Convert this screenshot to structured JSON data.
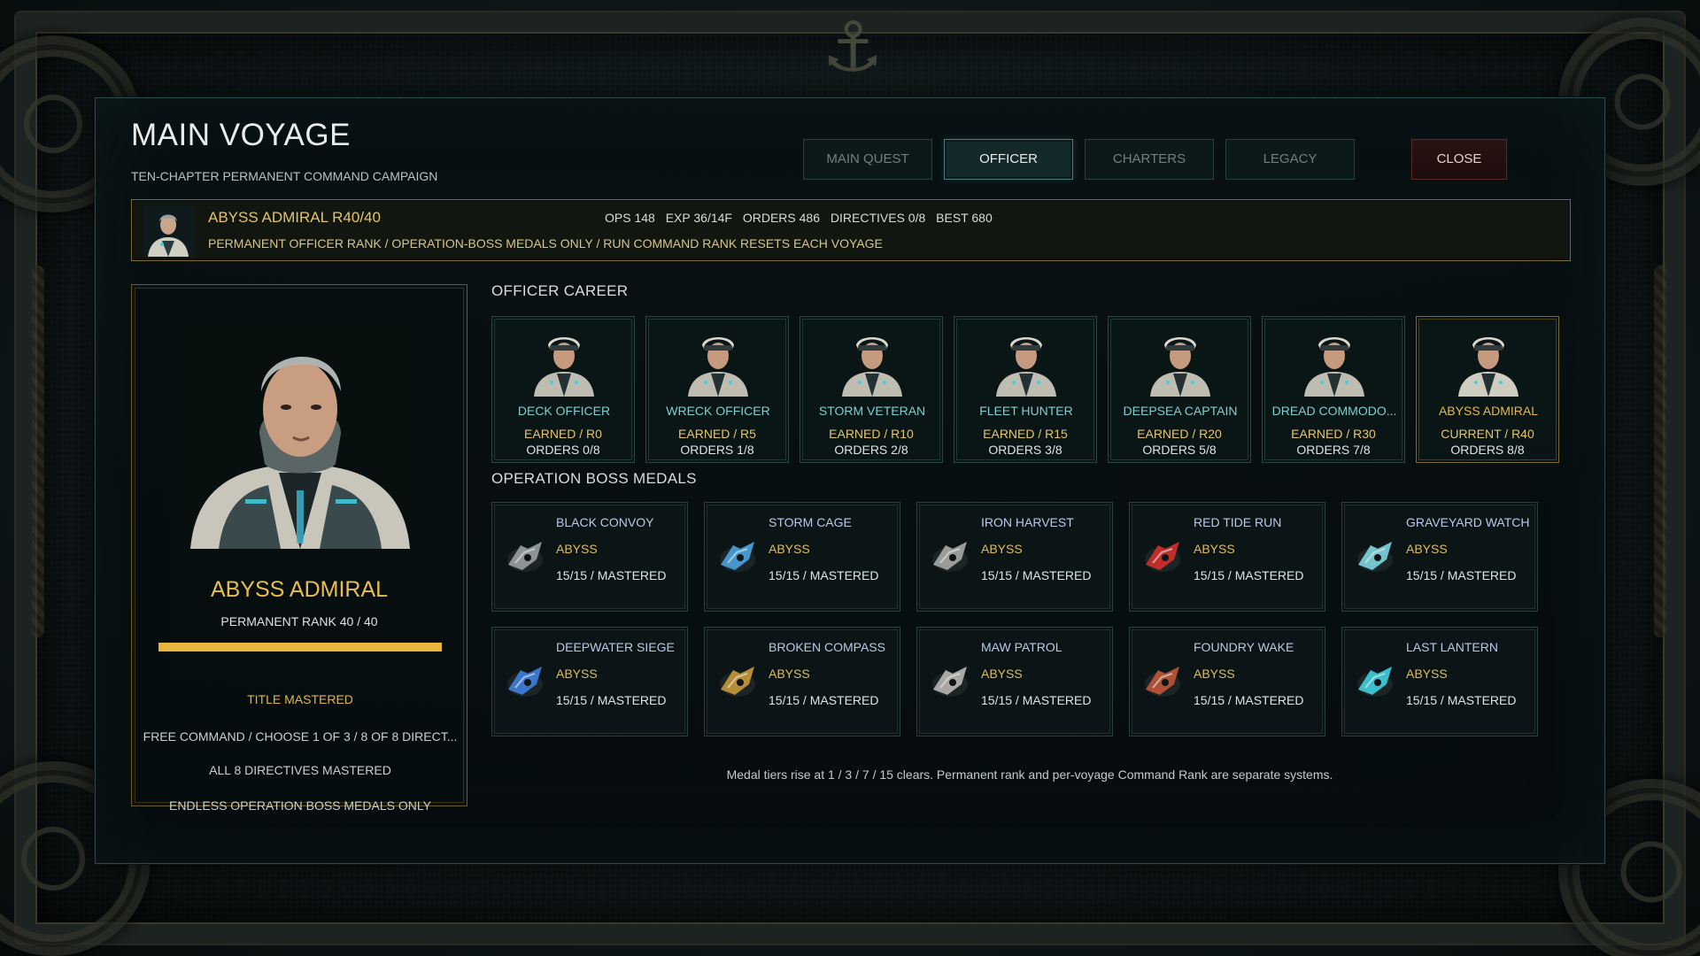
{
  "header": {
    "title": "MAIN VOYAGE",
    "subtitle": "TEN-CHAPTER PERMANENT COMMAND CAMPAIGN"
  },
  "tabs": [
    {
      "label": "MAIN QUEST",
      "active": false
    },
    {
      "label": "OFFICER",
      "active": true
    },
    {
      "label": "CHARTERS",
      "active": false
    },
    {
      "label": "LEGACY",
      "active": false
    }
  ],
  "close_label": "CLOSE",
  "banner": {
    "name": "ABYSS ADMIRAL  R40/40",
    "stats": {
      "ops": "OPS 148",
      "exp": "EXP 36/14F",
      "orders": "ORDERS 486",
      "directives": "DIRECTIVES 0/8",
      "best": "BEST 680"
    },
    "note": "PERMANENT OFFICER RANK / OPERATION-BOSS MEDALS ONLY / RUN COMMAND RANK RESETS EACH VOYAGE"
  },
  "profile": {
    "name": "ABYSS ADMIRAL",
    "rank": "PERMANENT RANK 40 / 40",
    "rank_progress": 1.0,
    "title_status": "TITLE MASTERED",
    "command_line": "FREE COMMAND / CHOOSE 1 OF 3 / 8 OF 8 DIRECT...",
    "directives_line": "ALL 8 DIRECTIVES MASTERED",
    "medals_line": "ENDLESS OPERATION BOSS MEDALS ONLY"
  },
  "officer_career": {
    "title": "OFFICER CAREER",
    "officers": [
      {
        "name": "DECK OFFICER",
        "status": "EARNED / R0",
        "orders": "ORDERS 0/8",
        "current": false
      },
      {
        "name": "WRECK OFFICER",
        "status": "EARNED / R5",
        "orders": "ORDERS 1/8",
        "current": false
      },
      {
        "name": "STORM VETERAN",
        "status": "EARNED / R10",
        "orders": "ORDERS 2/8",
        "current": false
      },
      {
        "name": "FLEET HUNTER",
        "status": "EARNED / R15",
        "orders": "ORDERS 3/8",
        "current": false
      },
      {
        "name": "DEEPSEA CAPTAIN",
        "status": "EARNED / R20",
        "orders": "ORDERS 5/8",
        "current": false
      },
      {
        "name": "DREAD COMMODO...",
        "status": "EARNED / R30",
        "orders": "ORDERS 7/8",
        "current": false
      },
      {
        "name": "ABYSS ADMIRAL",
        "status": "CURRENT / R40",
        "orders": "ORDERS 8/8",
        "current": true
      }
    ]
  },
  "boss_medals": {
    "title": "OPERATION BOSS MEDALS",
    "medals": [
      {
        "name": "BLACK CONVOY",
        "tier": "ABYSS",
        "progress": "15/15 / MASTERED",
        "icon": "black-convoy-medal-icon",
        "color": "#9aa0a3"
      },
      {
        "name": "STORM CAGE",
        "tier": "ABYSS",
        "progress": "15/15 / MASTERED",
        "icon": "storm-cage-medal-icon",
        "color": "#4aa3e0"
      },
      {
        "name": "IRON HARVEST",
        "tier": "ABYSS",
        "progress": "15/15 / MASTERED",
        "icon": "iron-harvest-medal-icon",
        "color": "#a9aaa6"
      },
      {
        "name": "RED TIDE RUN",
        "tier": "ABYSS",
        "progress": "15/15 / MASTERED",
        "icon": "red-tide-run-medal-icon",
        "color": "#d2302c"
      },
      {
        "name": "GRAVEYARD WATCH",
        "tier": "ABYSS",
        "progress": "15/15 / MASTERED",
        "icon": "graveyard-watch-medal-icon",
        "color": "#7fd6e0"
      },
      {
        "name": "DEEPWATER SIEGE",
        "tier": "ABYSS",
        "progress": "15/15 / MASTERED",
        "icon": "deepwater-siege-medal-icon",
        "color": "#3f7fe0"
      },
      {
        "name": "BROKEN COMPASS",
        "tier": "ABYSS",
        "progress": "15/15 / MASTERED",
        "icon": "broken-compass-medal-icon",
        "color": "#c89a3c"
      },
      {
        "name": "MAW PATROL",
        "tier": "ABYSS",
        "progress": "15/15 / MASTERED",
        "icon": "maw-patrol-medal-icon",
        "color": "#b8b8b2"
      },
      {
        "name": "FOUNDRY WAKE",
        "tier": "ABYSS",
        "progress": "15/15 / MASTERED",
        "icon": "foundry-wake-medal-icon",
        "color": "#c0553a"
      },
      {
        "name": "LAST LANTERN",
        "tier": "ABYSS",
        "progress": "15/15 / MASTERED",
        "icon": "last-lantern-medal-icon",
        "color": "#3fd0e0"
      }
    ]
  },
  "footnote": "Medal tiers rise at 1 / 3 / 7 / 15 clears. Permanent rank and per-voyage Command Rank are separate systems."
}
